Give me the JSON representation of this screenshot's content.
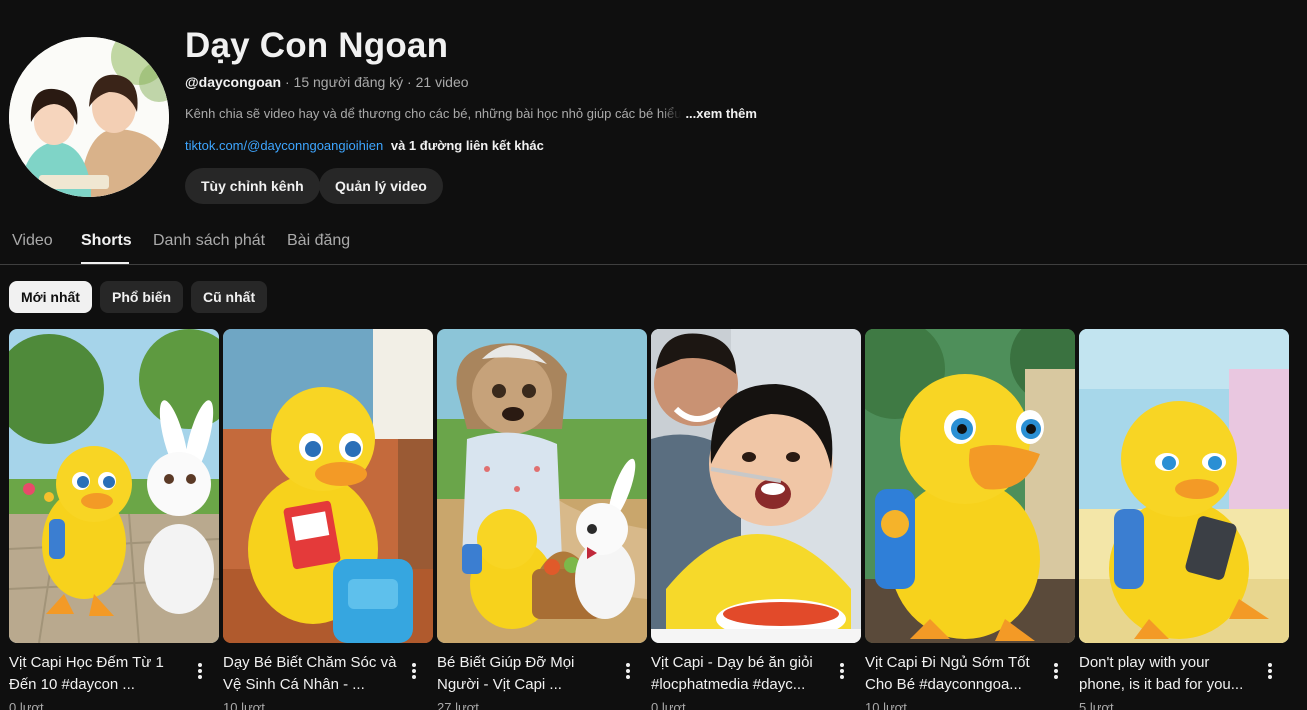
{
  "channel": {
    "name": "Dạy Con Ngoan",
    "handle": "@daycongoan",
    "stats": " · 15 người đăng ký · 21 video",
    "description": "Kênh chia sẽ video hay và dể thương cho các bé, những bài học nhỏ giúp các bé hiểu",
    "more_label": "...xem thêm",
    "link": "tiktok.com/@dayconngoangioihien",
    "other_links": "và 1 đường liên kết khác"
  },
  "actions": {
    "customize": "Tùy chỉnh kênh",
    "manage": "Quản lý video"
  },
  "tabs": [
    "Video",
    "Shorts",
    "Danh sách phát",
    "Bài đăng"
  ],
  "filters": [
    "Mới nhất",
    "Phổ biến",
    "Cũ nhất"
  ],
  "shorts": [
    {
      "title": "Vịt Capi Học Đếm Từ 1 Đến 10 #daycon ...",
      "views": "0 lượt"
    },
    {
      "title": "Dạy Bé Biết Chăm Sóc và Vệ Sinh Cá Nhân - ...",
      "views": "10 lượt"
    },
    {
      "title": "Bé Biết Giúp Đỡ Mọi Người - Vịt Capi ...",
      "views": "27 lượt"
    },
    {
      "title": "Vịt Capi - Dạy bé ăn giỏi #locphatmedia #dayc...",
      "views": "0 lượt"
    },
    {
      "title": "Vịt Capi Đi Ngủ Sớm Tốt Cho Bé #dayconngoa...",
      "views": "10 lượt"
    },
    {
      "title": "Don't play with your phone, is it bad for you...",
      "views": "5 lượt"
    }
  ],
  "colors": {
    "background": "#0f0f0f",
    "chip": "#272727",
    "link": "#3ea6ff",
    "duck": "#f7d21c"
  },
  "icons": {
    "more": "more-vert-icon"
  }
}
